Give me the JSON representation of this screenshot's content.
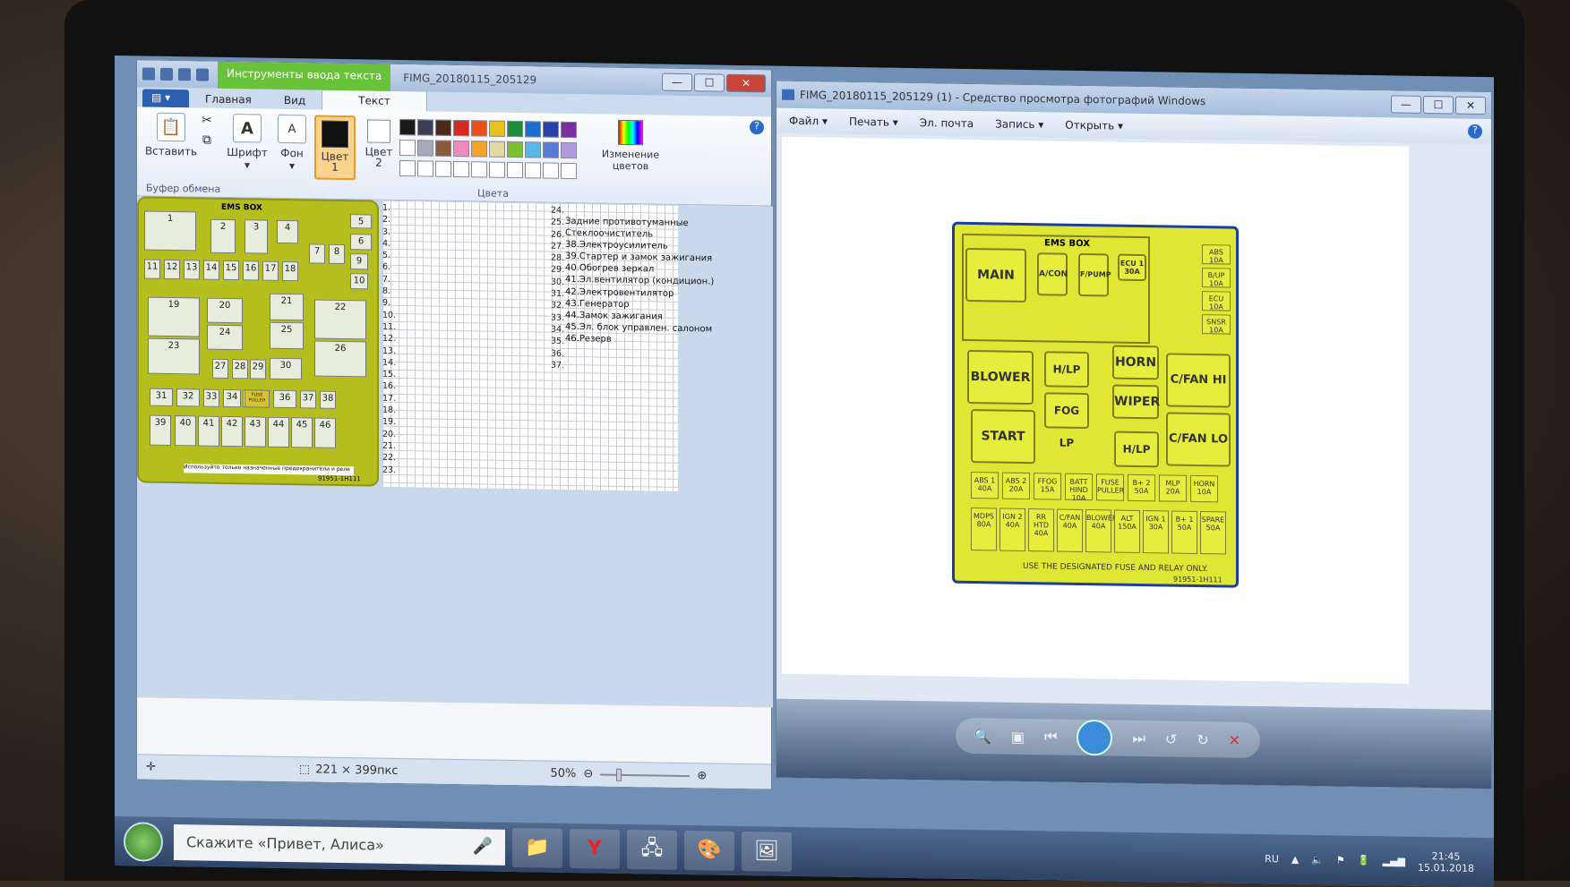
{
  "paint": {
    "ctx_tab": "Инструменты ввода текста",
    "title": "FIMG_20180115_205129",
    "tabs": [
      "Главная",
      "Вид",
      "Текст"
    ],
    "clipboard": {
      "paste": "Вставить",
      "group": "Буфер обмена"
    },
    "font": "Шрифт",
    "background": "Фон",
    "color1": "Цвет\n1",
    "color2": "Цвет\n2",
    "edit_colors": "Изменение цветов",
    "colors_group": "Цвета",
    "palette_row1": [
      "#1a1a1a",
      "#3c3f52",
      "#4a2a1a",
      "#d42a1f",
      "#e8501e",
      "#e6c31a",
      "#1e8c3a",
      "#1c6ed1",
      "#2c3fa8",
      "#7c2ea0"
    ],
    "palette_row2": [
      "#ffffff",
      "#a6a9b8",
      "#8a5a3a",
      "#f08aba",
      "#f2a428",
      "#e4d9a0",
      "#7cbf2e",
      "#5ab6e8",
      "#5a7ad8",
      "#b09ae0"
    ],
    "status_size": "221 × 399пкс",
    "zoom": "50%",
    "fusebox_title": "EMS BOX",
    "fusebox_note": "Используйте только назначенные предохранители и реле",
    "fusebox_code": "91951-1H111",
    "numbers_left": [
      "1.",
      "2.",
      "3.",
      "4.",
      "5.",
      "6.",
      "7.",
      "8.",
      "9.",
      "10.",
      "11.",
      "12.",
      "13.",
      "14.",
      "15.",
      "16.",
      "17.",
      "18.",
      "19.",
      "20.",
      "21.",
      "22.",
      "23."
    ],
    "numbers_right": [
      "24.",
      "25.",
      "26.",
      "27.",
      "28.",
      "29.",
      "30.",
      "31.",
      "32.",
      "33.",
      "34.",
      "35.",
      "36.",
      "37."
    ],
    "notes": [
      "Задние противотуманные",
      "Стеклоочиститель",
      "",
      "",
      "",
      "",
      "",
      "",
      "",
      "",
      "",
      "",
      "",
      "",
      "38.Электроусилитель",
      "39.Стартер и замок зажигания",
      "40.Обогрев зеркал",
      "41.Эл.вентилятор (кондицион.)",
      "42.Электровентилятор",
      "43.Генератор",
      "44.Замок зажигания",
      "45.Эл. блок управлен. салоном",
      "46.Резерв"
    ],
    "fuse_labels": [
      "1",
      "2",
      "3",
      "4",
      "5",
      "6",
      "7",
      "8",
      "9",
      "10",
      "11",
      "12",
      "13",
      "14",
      "15",
      "16",
      "17",
      "18",
      "19",
      "20",
      "21",
      "22",
      "23",
      "24",
      "25",
      "26",
      "27",
      "28",
      "29",
      "30",
      "31",
      "32",
      "33",
      "34",
      "35",
      "36",
      "37",
      "38",
      "39",
      "40",
      "41",
      "42",
      "43",
      "44",
      "45",
      "46"
    ],
    "fuse_puller": "FUSE PULLER"
  },
  "viewer": {
    "title": "FIMG_20180115_205129 (1) - Средство просмотра фотографий Windows",
    "menu": [
      "Файл",
      "Печать",
      "Эл. почта",
      "Запись",
      "Открыть"
    ],
    "box": {
      "title": "EMS BOX",
      "main": "MAIN",
      "aircon": "A/CON",
      "fpump": "F/PUMP",
      "ecu1": "ECU 1 30A",
      "abs": "ABS 10A",
      "bup": "B/UP 10A",
      "ecu": "ECU 10A",
      "snsr": "SNSR 10A",
      "blower": "BLOWER",
      "hlphi": "H/LP HI",
      "horn": "HORN",
      "cfanhi": "C/FAN HI",
      "foglp": "FOG LP",
      "wiper": "WIPER",
      "start": "START",
      "hlplo": "H/LP LO",
      "cfanlo": "C/FAN LO",
      "row_small": [
        "ABS 1 40A",
        "ABS 2 20A",
        "FFOG 15A",
        "BATT HIND 10A",
        "FUSE PULLER",
        "B+ 2 50A",
        "MLP 20A",
        "HORN 10A"
      ],
      "row_big": [
        "MDPS 80A",
        "IGN 2 40A",
        "RR HTD 40A",
        "C/FAN 40A",
        "BLOWER 40A",
        "ALT 150A",
        "IGN 1 30A",
        "B+ 1 50A",
        "SPARE 50A"
      ],
      "footer": "USE THE DESIGNATED FUSE AND RELAY ONLY.",
      "code": "91951-1H111"
    }
  },
  "taskbar": {
    "search_text": "Скажите «Привет, Алиса»",
    "lang": "RU",
    "time": "21:45",
    "date": "15.01.2018"
  }
}
